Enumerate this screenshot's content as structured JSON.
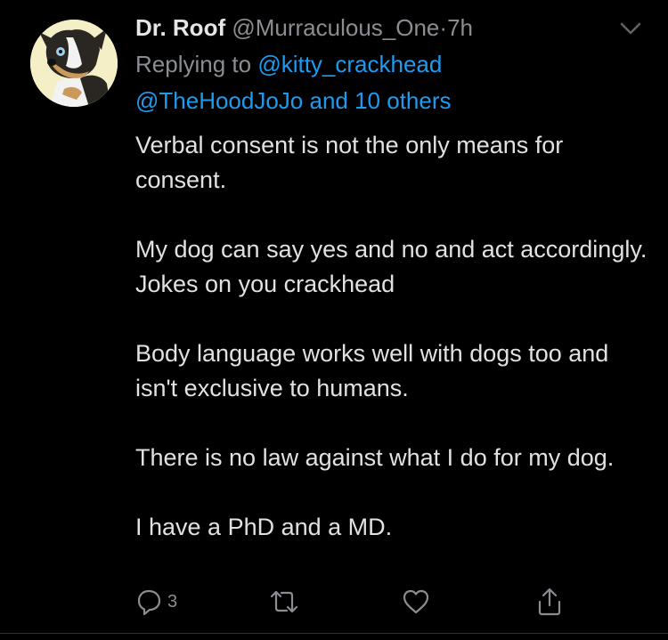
{
  "tweet": {
    "display_name": "Dr. Roof",
    "handle": "@Murraculous_One",
    "separator": "·",
    "time": "7h",
    "replying_prefix": "Replying to ",
    "replying_to_primary": "@kitty_crackhead",
    "replying_to_secondary": "@TheHoodJoJo and 10 others",
    "paragraphs": [
      "Verbal consent is not the only means for consent.",
      "My dog can say yes and no and act accordingly.  Jokes on you crackhead",
      "Body language works well with dogs too and isn't exclusive to humans.",
      "There is no law against what I do for my dog.",
      "I have a PhD and a MD."
    ],
    "reply_count": "3"
  },
  "icons": {
    "avatar": "avatar-illustration",
    "menu": "chevron-down-icon",
    "reply": "reply-icon",
    "retweet": "retweet-icon",
    "like": "heart-icon",
    "share": "share-icon"
  },
  "colors": {
    "background": "#000000",
    "text": "#e1e1e1",
    "muted": "#8a8d91",
    "link": "#1d9bf0",
    "avatar_bg": "#f5efc8"
  }
}
